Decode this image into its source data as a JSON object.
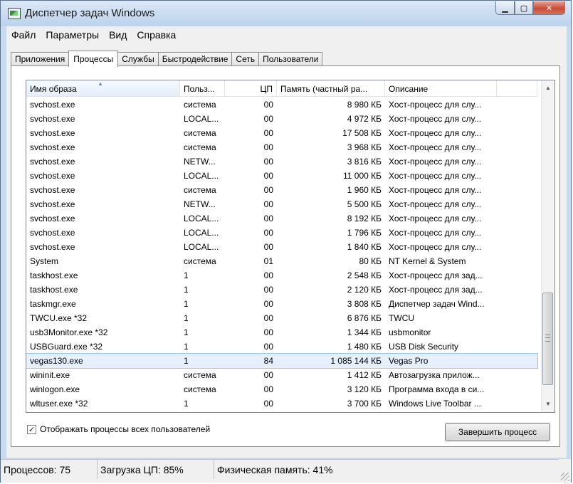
{
  "window": {
    "title": "Диспетчер задач Windows"
  },
  "menu": [
    "Файл",
    "Параметры",
    "Вид",
    "Справка"
  ],
  "tabs": [
    {
      "label": "Приложения",
      "active": false
    },
    {
      "label": "Процессы",
      "active": true
    },
    {
      "label": "Службы",
      "active": false
    },
    {
      "label": "Быстродействие",
      "active": false
    },
    {
      "label": "Сеть",
      "active": false
    },
    {
      "label": "Пользователи",
      "active": false
    }
  ],
  "columns": [
    "Имя образа",
    "Польз...",
    "ЦП",
    "Память (частный ра...",
    "Описание"
  ],
  "processes": [
    [
      "svchost.exe",
      "система",
      "00",
      "8 980 КБ",
      "Хост-процесс для слу..."
    ],
    [
      "svchost.exe",
      "LOCAL...",
      "00",
      "4 972 КБ",
      "Хост-процесс для слу..."
    ],
    [
      "svchost.exe",
      "система",
      "00",
      "17 508 КБ",
      "Хост-процесс для слу..."
    ],
    [
      "svchost.exe",
      "система",
      "00",
      "3 968 КБ",
      "Хост-процесс для слу..."
    ],
    [
      "svchost.exe",
      "NETW...",
      "00",
      "3 816 КБ",
      "Хост-процесс для слу..."
    ],
    [
      "svchost.exe",
      "LOCAL...",
      "00",
      "11 000 КБ",
      "Хост-процесс для слу..."
    ],
    [
      "svchost.exe",
      "система",
      "00",
      "1 960 КБ",
      "Хост-процесс для слу..."
    ],
    [
      "svchost.exe",
      "NETW...",
      "00",
      "5 500 КБ",
      "Хост-процесс для слу..."
    ],
    [
      "svchost.exe",
      "LOCAL...",
      "00",
      "8 192 КБ",
      "Хост-процесс для слу..."
    ],
    [
      "svchost.exe",
      "LOCAL...",
      "00",
      "1 796 КБ",
      "Хост-процесс для слу..."
    ],
    [
      "svchost.exe",
      "LOCAL...",
      "00",
      "1 840 КБ",
      "Хост-процесс для слу..."
    ],
    [
      "System",
      "система",
      "01",
      "80 КБ",
      "NT Kernel & System"
    ],
    [
      "taskhost.exe",
      "1",
      "00",
      "2 548 КБ",
      "Хост-процесс для зад..."
    ],
    [
      "taskhost.exe",
      "1",
      "00",
      "2 120 КБ",
      "Хост-процесс для зад..."
    ],
    [
      "taskmgr.exe",
      "1",
      "00",
      "3 808 КБ",
      "Диспетчер задач Wind..."
    ],
    [
      "TWCU.exe *32",
      "1",
      "00",
      "6 876 КБ",
      "TWCU"
    ],
    [
      "usb3Monitor.exe *32",
      "1",
      "00",
      "1 344 КБ",
      "usbmonitor"
    ],
    [
      "USBGuard.exe *32",
      "1",
      "00",
      "1 480 КБ",
      "USB Disk Security"
    ],
    [
      "vegas130.exe",
      "1",
      "84",
      "1 085 144 КБ",
      "Vegas Pro"
    ],
    [
      "wininit.exe",
      "система",
      "00",
      "1 412 КБ",
      "Автозагрузка прилож..."
    ],
    [
      "winlogon.exe",
      "система",
      "00",
      "3 120 КБ",
      "Программа входа в си..."
    ],
    [
      "wltuser.exe *32",
      "1",
      "00",
      "3 700 КБ",
      "Windows Live Toolbar ..."
    ]
  ],
  "selected_process": "vegas130.exe",
  "show_all_users": {
    "label": "Отображать процессы всех пользователей",
    "checked": true
  },
  "end_process_label": "Завершить процесс",
  "status": {
    "processes": "Процессов: 75",
    "cpu": "Загрузка ЦП: 85%",
    "memory": "Физическая память: 41%"
  }
}
